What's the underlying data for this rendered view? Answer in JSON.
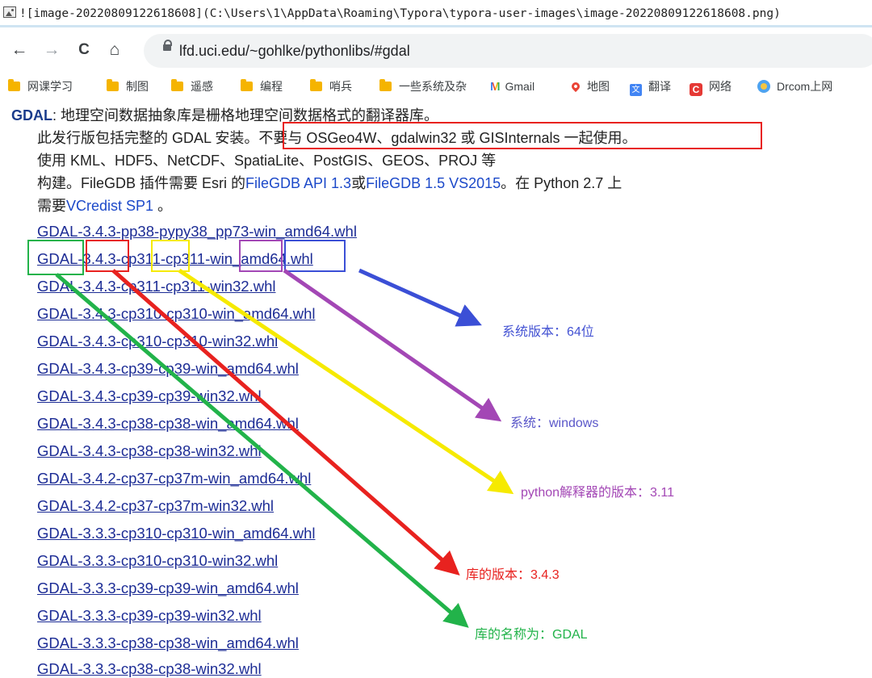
{
  "markdown_line": "![image-20220809122618608](C:\\Users\\1\\AppData\\Roaming\\Typora\\typora-user-images\\image-20220809122618608.png)",
  "nav": {
    "back": "←",
    "forward": "→",
    "reload": "C",
    "home": "⌂",
    "url": "lfd.uci.edu/~gohlke/pythonlibs/#gdal"
  },
  "bookmarks": [
    "网课学习",
    "制图",
    "遥感",
    "编程",
    "哨兵",
    "一些系统及杂",
    "Gmail",
    "地图",
    "翻译",
    "网络",
    "Drcom上网"
  ],
  "page": {
    "gdal_name": "GDAL",
    "line1_rest": ": 地理空间数据抽象库是栅格地理空间数据格式的翻译器库。",
    "line2_a": "此发行版包括完整的 GDAL 安装。",
    "line2_b": "不要与 OSGeo4W、gdalwin32 或 GISInternals 一起使用。",
    "line3": "使用 KML、HDF5、NetCDF、SpatiaLite、PostGIS、GEOS、PROJ 等",
    "line4_a": "构建。FileGDB 插件需要 Esri 的",
    "line4_link1": "FileGDB API 1.3",
    "line4_or": "或",
    "line4_link2": "FileGDB 1.5 VS2015",
    "line4_b": "。在 Python 2.7 上",
    "line5_a": "需要",
    "line5_link": "VCredist SP1",
    "line5_b": " 。"
  },
  "whl_files": [
    "GDAL-3.4.3-pp38-pypy38_pp73-win_amd64.whl",
    "GDAL-3.4.3-cp311-cp311-win_amd64.whl",
    "GDAL-3.4.3-cp311-cp311-win32.whl",
    "GDAL-3.4.3-cp310-cp310-win_amd64.whl",
    "GDAL-3.4.3-cp310-cp310-win32.whl",
    "GDAL-3.4.3-cp39-cp39-win_amd64.whl",
    "GDAL-3.4.3-cp39-cp39-win32.whl",
    "GDAL-3.4.3-cp38-cp38-win_amd64.whl",
    "GDAL-3.4.3-cp38-cp38-win32.whl",
    "GDAL-3.4.2-cp37-cp37m-win_amd64.whl",
    "GDAL-3.4.2-cp37-cp37m-win32.whl",
    "GDAL-3.3.3-cp310-cp310-win_amd64.whl",
    "GDAL-3.3.3-cp310-cp310-win32.whl",
    "GDAL-3.3.3-cp39-cp39-win_amd64.whl",
    "GDAL-3.3.3-cp39-cp39-win32.whl",
    "GDAL-3.3.3-cp38-cp38-win_amd64.whl",
    "GDAL-3.3.3-cp38-cp38-win32.whl"
  ],
  "annotations": {
    "platform_bits": "系统版本：64位",
    "os": "系统：windows",
    "python_version": "python解释器的版本：3.11",
    "lib_version": "库的版本：3.4.3",
    "lib_name": "库的名称为：GDAL"
  },
  "colors": {
    "blue": "#3b4fd6",
    "purple": "#a347b5",
    "yellow": "#f6ea00",
    "red": "#e8221f",
    "green": "#22b34a"
  }
}
